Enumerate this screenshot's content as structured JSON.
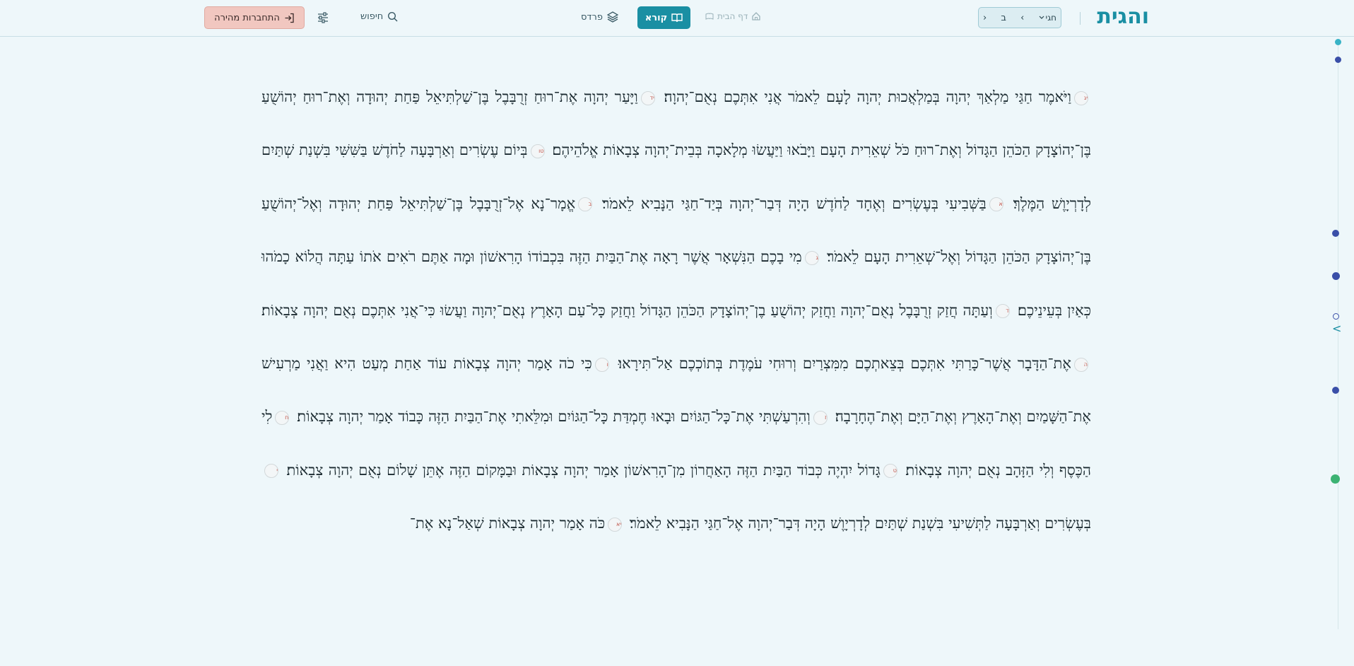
{
  "header": {
    "logo": "והגית",
    "nav": {
      "book": "חגי",
      "chapter": "ב",
      "prev_label": "‹",
      "next_label": "›"
    },
    "home_label": "דף הבית",
    "reader_label": "קורא",
    "pardes_label": "פרדס",
    "search_label": "חיפוש",
    "login_label": "התחברות מהירה"
  },
  "colors": {
    "accent": "#1a8fa3",
    "login_bg": "#f1c7c0",
    "verse_num": "#c0544a",
    "rail_active": "#3a4fa8",
    "rail_green": "#3bb273"
  },
  "text": {
    "verses": [
      {
        "num": "יג",
        "text": "וַיֹּאמֶר חַגַּי מַלְאַךְ יְהוָה בְּמַלְאֲכוּת יְהוָה לָעָם לֵאמֹר אֲנִי אִתְּכֶם נְאֻם־יְהוָה׃"
      },
      {
        "num": "יד",
        "text": "וַיָּעַר יְהוָה אֶת־רוּחַ זְרֻבָּבֶל בֶּן־שַׁלְתִּיאֵל פַּחַת יְהוּדָה וְאֶת־רוּחַ יְהוֹשֻׁעַ בֶּן־יְהוֹצָדָק הַכֹּהֵן הַגָּדוֹל וְאֶת־רוּחַ כֹּל שְׁאֵרִית הָעָם וַיָּבֹאוּ וַיַּעֲשׂוּ מְלָאכָה בְּבֵית־יְהוָה צְבָאוֹת אֱלֹהֵיהֶם׃"
      },
      {
        "num": "טו",
        "text": "בְּיוֹם עֶשְׂרִים וְאַרְבָּעָה לַחֹדֶשׁ בַּשִּׁשִּׁי בִּשְׁנַת שְׁתַּיִם לְדָרְיָוֶשׁ הַמֶּלֶךְ׃"
      },
      {
        "num": "א",
        "text": "בַּשְּׁבִיעִי בְּעֶשְׂרִים וְאֶחָד לַחֹדֶשׁ הָיָה דְּבַר־יְהוָה בְּיַד־חַגַּי הַנָּבִיא לֵאמֹר׃"
      },
      {
        "num": "ב",
        "text": "אֱמָר־נָא אֶל־זְרֻבָּבֶל בֶּן־שַׁלְתִּיאֵל פַּחַת יְהוּדָה וְאֶל־יְהוֹשֻׁעַ בֶּן־יְהוֹצָדָק הַכֹּהֵן הַגָּדוֹל וְאֶל־שְׁאֵרִית הָעָם לֵאמֹר׃"
      },
      {
        "num": "ג",
        "text": "מִי בָכֶם הַנִּשְׁאָר אֲשֶׁר רָאָה אֶת־הַבַּיִת הַזֶּה בִּכְבוֹדוֹ הָרִאשׁוֹן וּמָה אַתֶּם רֹאִים אֹתוֹ עַתָּה הֲלוֹא כָמֹהוּ כְּאַיִן בְּעֵינֵיכֶם׃"
      },
      {
        "num": "ד",
        "text": "וְעַתָּה חֲזַק זְרֻבָּבֶל נְאֻם־יְהוָה וַחֲזַק יְהוֹשֻׁעַ בֶן־יְהוֹצָדָק הַכֹּהֵן הַגָּדוֹל וַחֲזַק כָּל־עַם הָאָרֶץ נְאֻם־יְהוָה וַעֲשׂוּ כִּי־אֲנִי אִתְּכֶם נְאֻם יְהוָה צְבָאוֹת׃"
      },
      {
        "num": "ה",
        "text": "אֶת־הַדָּבָר אֲשֶׁר־כָּרַתִּי אִתְּכֶם בְּצֵאתְכֶם מִמִּצְרַיִם וְרוּחִי עֹמֶדֶת בְּתוֹכְכֶם אַל־תִּירָאוּ׃"
      },
      {
        "num": "ו",
        "text": "כִּי כֹה אָמַר יְהוָה צְבָאוֹת עוֹד אַחַת מְעַט הִיא וַאֲנִי מַרְעִישׁ אֶת־הַשָּׁמַיִם וְאֶת־הָאָרֶץ וְאֶת־הַיָּם וְאֶת־הֶחָרָבָה׃"
      },
      {
        "num": "ז",
        "text": "וְהִרְעַשְׁתִּי אֶת־כָּל־הַגּוֹיִם וּבָאוּ חֶמְדַּת כָּל־הַגּוֹיִם וּמִלֵּאתִי אֶת־הַבַּיִת הַזֶּה כָּבוֹד אָמַר יְהוָה צְבָאוֹת׃"
      },
      {
        "num": "ח",
        "text": "לִי הַכֶּסֶף וְלִי הַזָּהָב נְאֻם יְהוָה צְבָאוֹת׃"
      },
      {
        "num": "ט",
        "text": "גָּדוֹל יִהְיֶה כְּבוֹד הַבַּיִת הַזֶּה הָאַחֲרוֹן מִן־הָרִאשׁוֹן אָמַר יְהוָה צְבָאוֹת וּבַמָּקוֹם הַזֶּה אֶתֵּן שָׁלוֹם נְאֻם יְהוָה צְבָאוֹת׃"
      },
      {
        "num": "י",
        "text": "בְּעֶשְׂרִים וְאַרְבָּעָה לַתְּשִׁיעִי בִּשְׁנַת שְׁתַּיִם לְדָרְיָוֶשׁ הָיָה דְּבַר־יְהוָה אֶל־חַגַּי הַנָּבִיא לֵאמֹר׃"
      },
      {
        "num": "יא",
        "text": "כֹּה אָמַר יְהוָה צְבָאוֹת שְׁאַל־נָא אֶת־"
      }
    ]
  },
  "rail": {
    "icons": [
      "verse-marker-icon",
      "collapse-chevron-icon"
    ],
    "chevron_label": "<"
  }
}
